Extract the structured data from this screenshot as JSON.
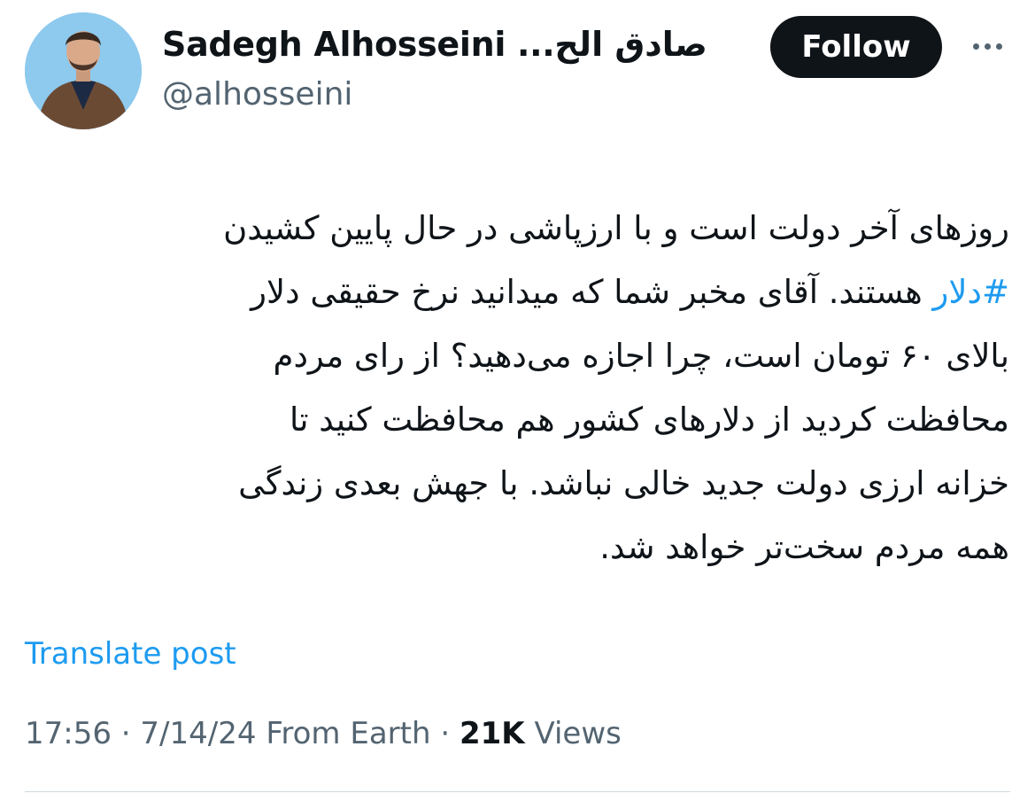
{
  "user": {
    "display_name": "Sadegh Alhosseini ...صادق الح",
    "handle": "@alhosseini"
  },
  "actions": {
    "follow_label": "Follow",
    "more_icon": "more-horizontal-icon"
  },
  "tweet": {
    "hashtag": "#دلار",
    "lines": [
      "روزهای آخر دولت است و با ارزپاشی در حال پایین کشیدن",
      "هستند. آقای مخبر شما که میدانید نرخ حقیقی دلار",
      "بالای ۶۰ تومان است، چرا اجازه می‌دهید؟ از رای مردم",
      "محافظت کردید از دلارهای کشور هم محافظت کنید تا",
      "خزانه ارزی دولت جدید خالی نباشد. با جهش بعدی زندگی",
      "همه مردم سخت‌تر خواهد شد."
    ]
  },
  "translate_label": "Translate post",
  "meta": {
    "time": "17:56",
    "date": "7/14/24",
    "source": "From Earth",
    "separator": "·",
    "views_count": "21K",
    "views_label": "Views"
  },
  "colors": {
    "link": "#1d9bf0",
    "text": "#0f1419",
    "secondary": "#536471",
    "follow_bg": "#0f1419",
    "avatar_bg": "#8ec9ee"
  }
}
